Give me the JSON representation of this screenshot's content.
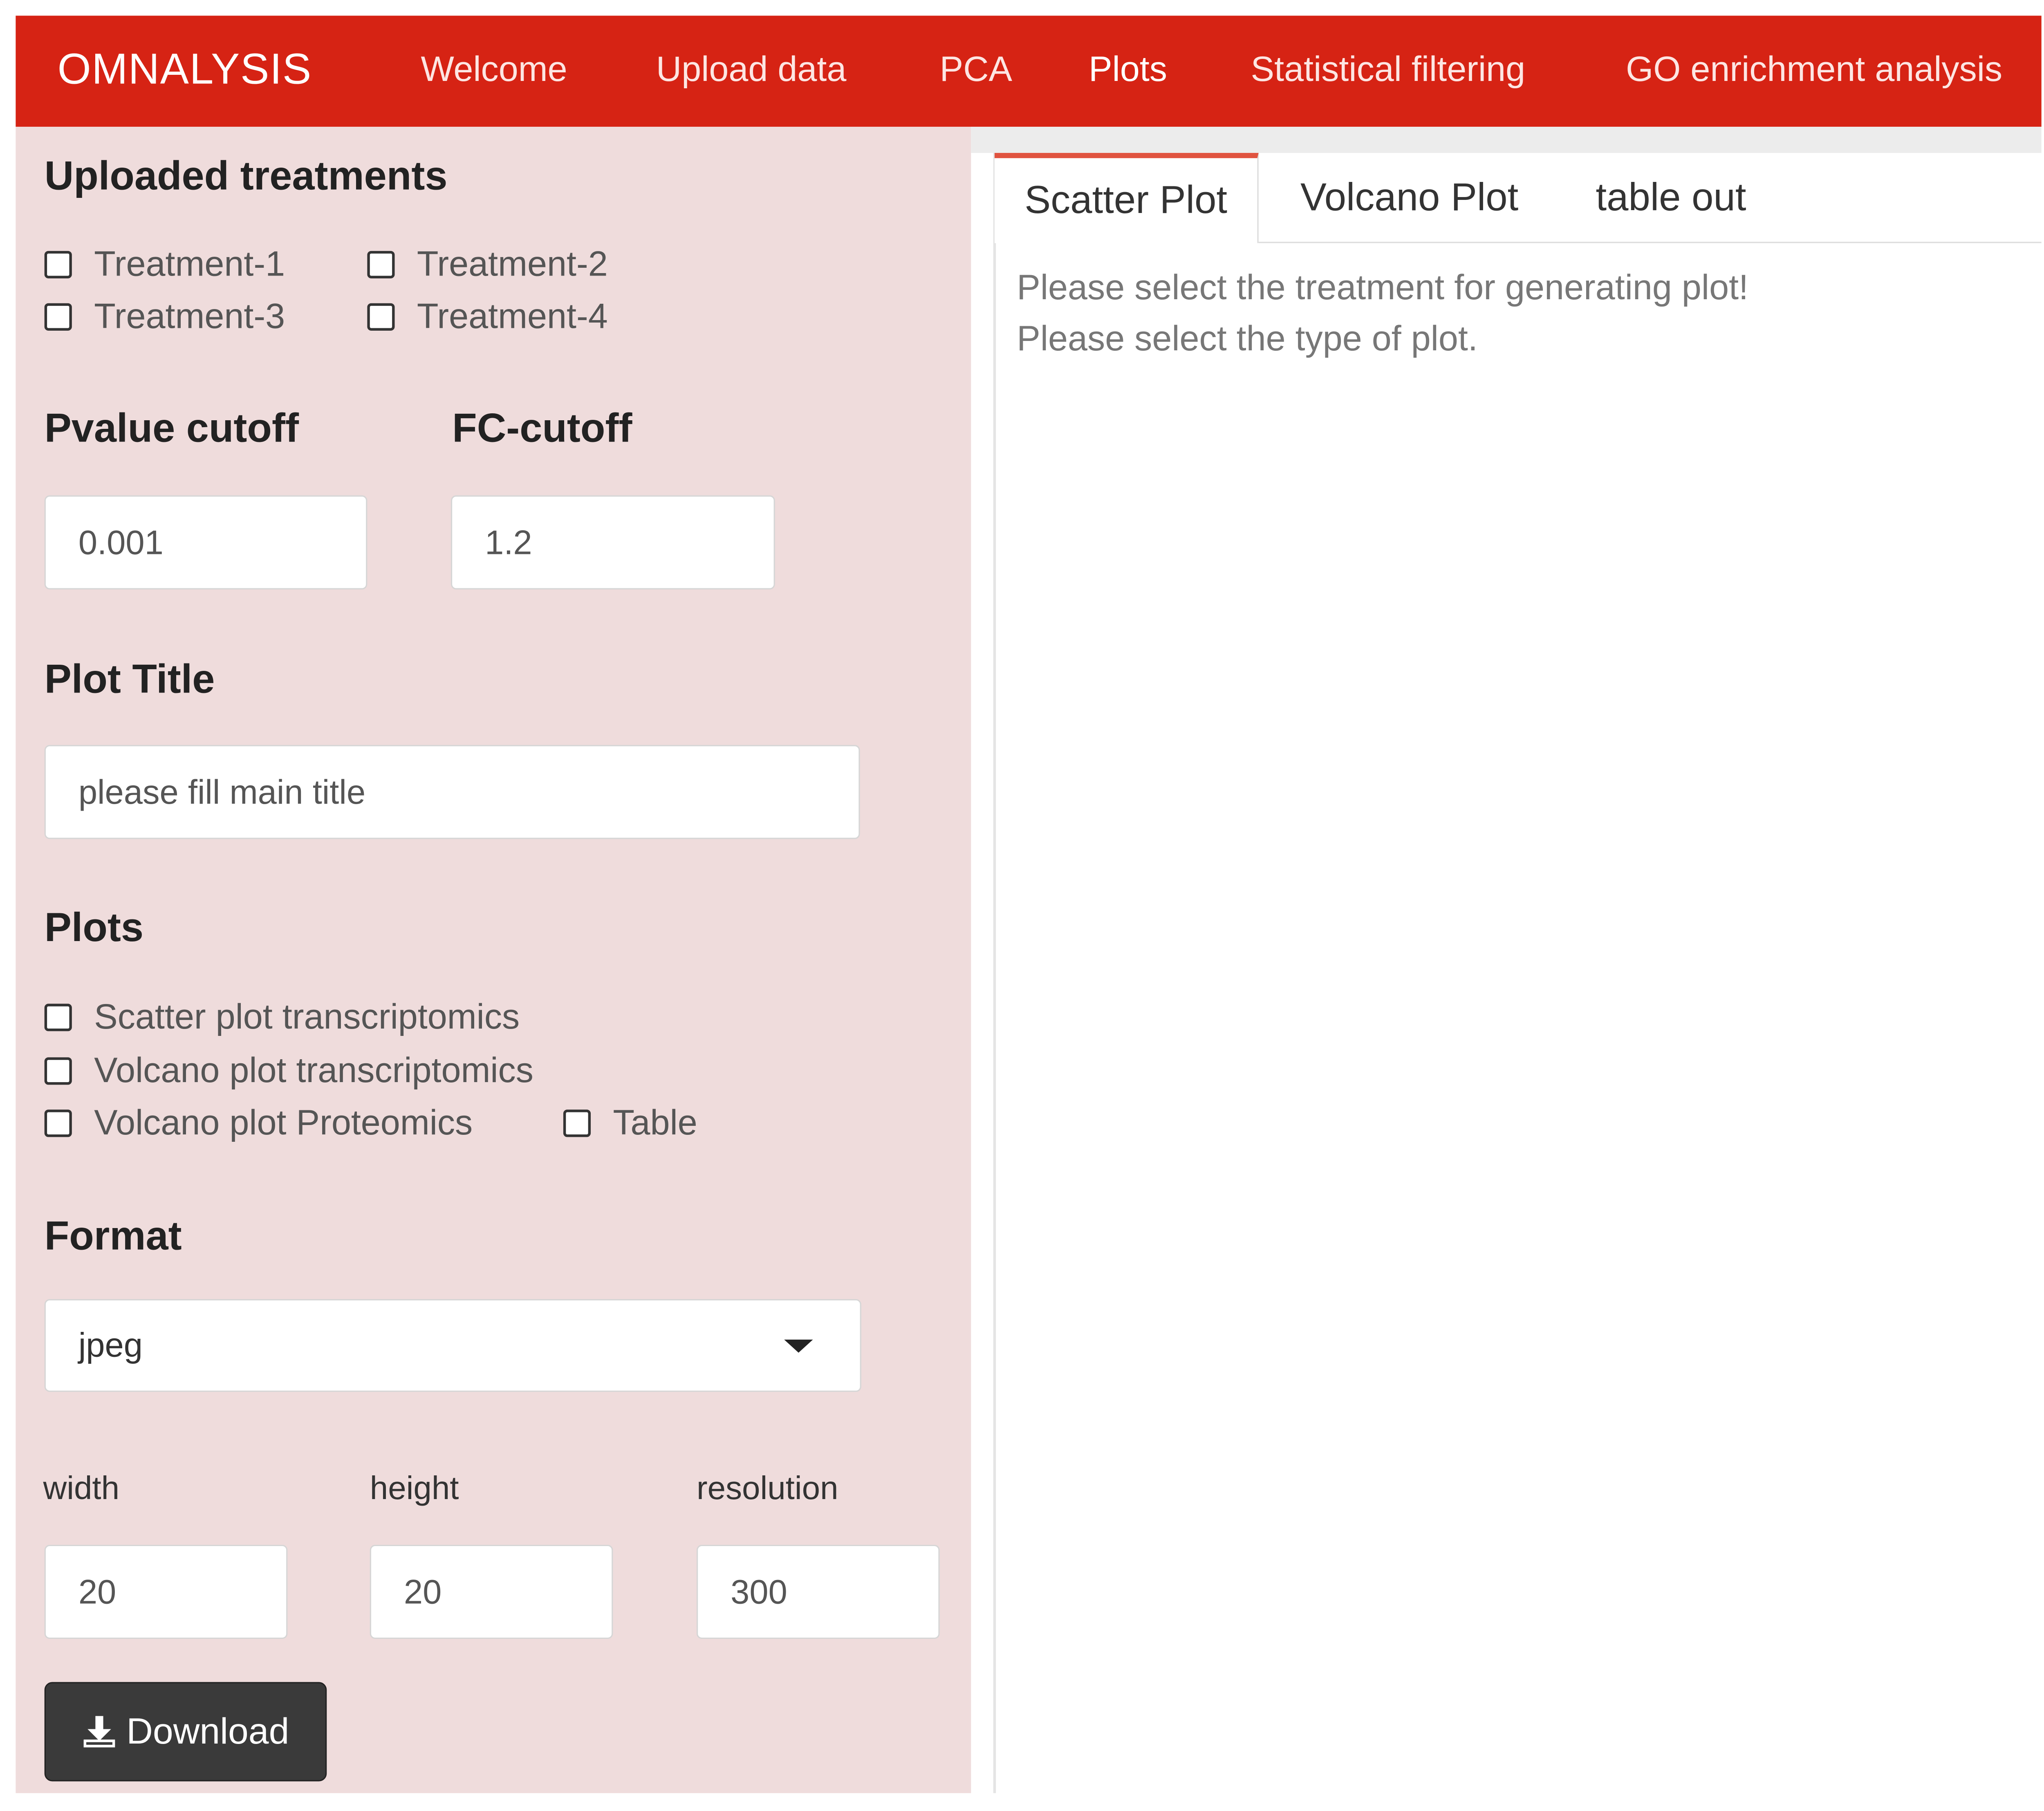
{
  "navbar": {
    "brand": "OMNALYSIS",
    "items": [
      {
        "label": "Welcome"
      },
      {
        "label": "Upload data"
      },
      {
        "label": "PCA"
      },
      {
        "label": "Plots",
        "active": true
      },
      {
        "label": "Statistical filtering"
      },
      {
        "label": "GO enrichment analysis"
      }
    ],
    "color": "#d62314"
  },
  "sidebar": {
    "treatments": {
      "title": "Uploaded treatments",
      "options": [
        "Treatment-1",
        "Treatment-2",
        "Treatment-3",
        "Treatment-4"
      ]
    },
    "pvalue": {
      "label": "Pvalue cutoff",
      "value": "0.001"
    },
    "fc": {
      "label": "FC-cutoff",
      "value": "1.2"
    },
    "plot_title": {
      "label": "Plot Title",
      "placeholder": "please fill main title"
    },
    "plots": {
      "title": "Plots",
      "options": [
        "Scatter plot transcriptomics",
        "Volcano plot transcriptomics",
        "Volcano plot Proteomics",
        "Table"
      ]
    },
    "format": {
      "label": "Format",
      "selected": "jpeg"
    },
    "width": {
      "label": "width",
      "value": "20"
    },
    "height": {
      "label": "height",
      "value": "20"
    },
    "resolution": {
      "label": "resolution",
      "value": "300"
    },
    "download_label": "Download",
    "background": "#efdcdc"
  },
  "main": {
    "tabs": [
      {
        "label": "Scatter Plot",
        "active": true
      },
      {
        "label": "Volcano Plot"
      },
      {
        "label": "table out"
      }
    ],
    "messages": [
      "Please select the treatment for generating plot!",
      "Please select the type of plot."
    ]
  }
}
